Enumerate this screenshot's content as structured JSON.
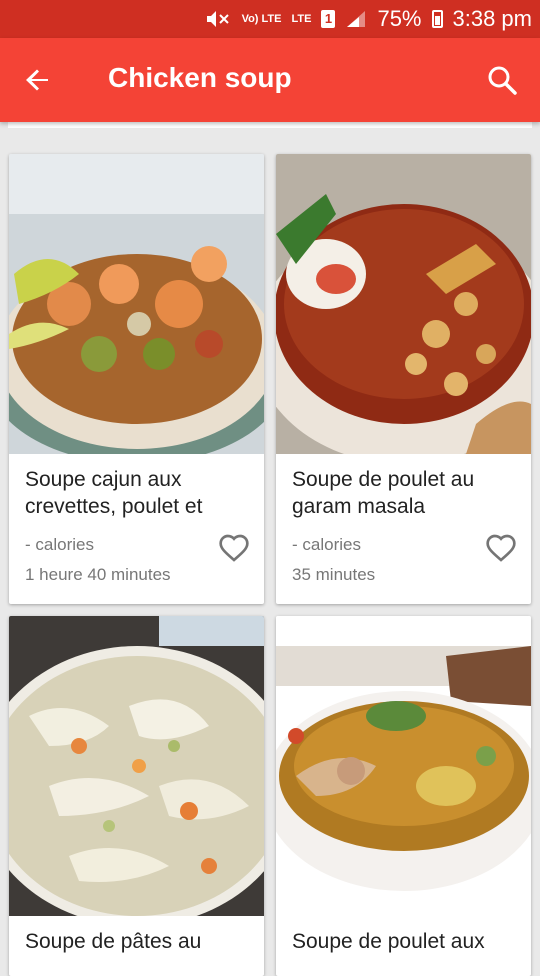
{
  "status_bar": {
    "network_label_1": "Vo) LTE",
    "network_label_2": "LTE",
    "sim": "1",
    "battery": "75%",
    "time": "3:38 pm"
  },
  "app_bar": {
    "title": "Chicken soup",
    "back_icon": "arrow-back-icon",
    "search_icon": "search-icon"
  },
  "recipes": [
    {
      "title": "Soupe cajun aux crevettes, poulet et",
      "calories": "- calories",
      "time": "1 heure 40 minutes",
      "favorite_icon": "heart-outline-icon"
    },
    {
      "title": "Soupe de poulet au garam masala",
      "calories": "- calories",
      "time": "35 minutes",
      "favorite_icon": "heart-outline-icon"
    },
    {
      "title": "Soupe de pâtes au"
    },
    {
      "title": "Soupe de poulet aux"
    }
  ],
  "colors": {
    "status_bar": "#cf2f22",
    "app_bar": "#f44336",
    "background": "#e9e9e9"
  }
}
